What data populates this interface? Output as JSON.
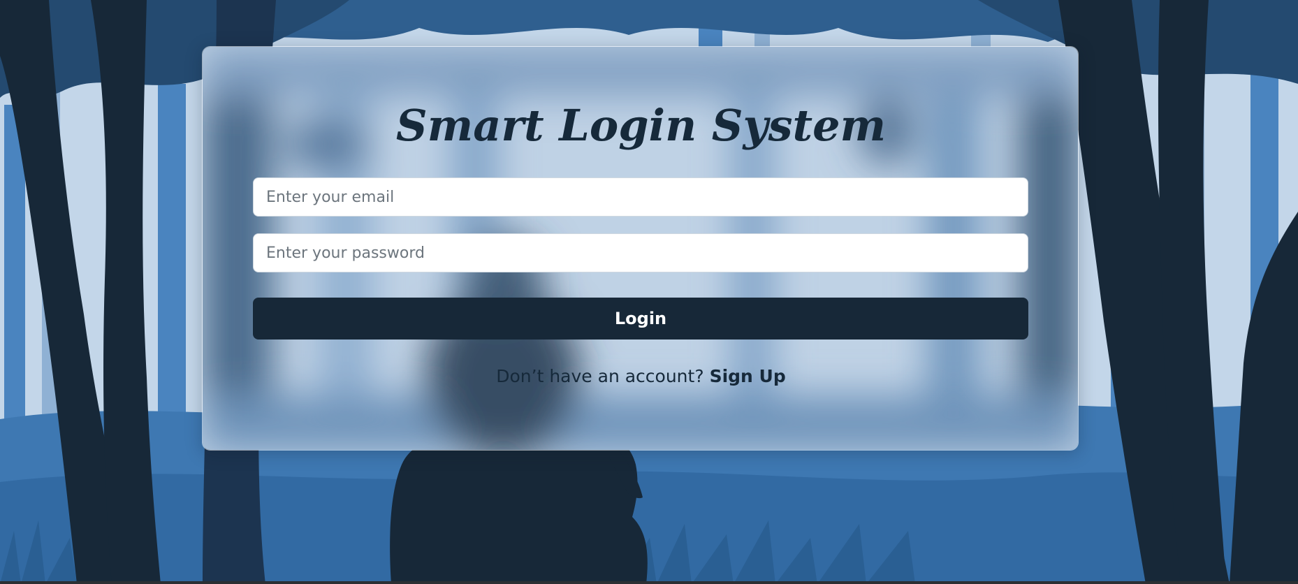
{
  "app": {
    "title": "Smart Login System"
  },
  "form": {
    "email_placeholder": "Enter your email",
    "email_value": "",
    "password_placeholder": "Enter your password",
    "password_value": "",
    "login_label": "Login"
  },
  "footer": {
    "prompt": "Don’t have an account?",
    "signup_label": "Sign Up"
  },
  "colors": {
    "sky": "#c3d6e9",
    "mid_blue": "#3e78b2",
    "dark_navy": "#172838",
    "button": "#172838"
  }
}
